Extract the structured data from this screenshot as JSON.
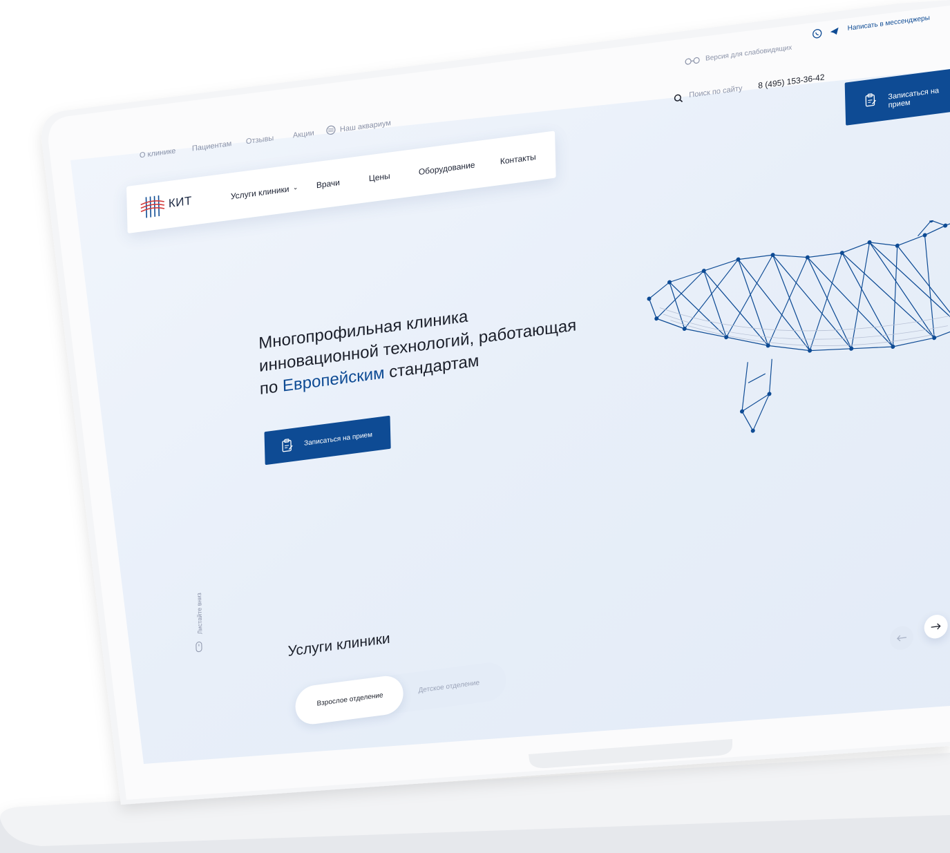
{
  "topbar": {
    "links": [
      "О клинике",
      "Пациентам",
      "Отзывы",
      "Акции"
    ],
    "aquarium": "Наш аквариум",
    "visually_impaired": "Версия для слабовидящих",
    "messenger": "Написать в мессенджеры",
    "search_placeholder": "Поиск по сайту",
    "phone": "8 (495) 153-36-42",
    "book_button": "Записаться на прием"
  },
  "navbar": {
    "logo": "КИТ",
    "items": [
      "Услуги клиники",
      "Врачи",
      "Цены",
      "Оборудование",
      "Контакты"
    ]
  },
  "hero": {
    "line1": "Многопрофильная клиника",
    "line2": "инновационной технологий, работающая",
    "line3_prefix": "по",
    "line3_accent": "Европейским",
    "line3_suffix": "стандартам",
    "button": "Записаться на прием"
  },
  "scroll_hint": "Листайте вниз",
  "services": {
    "title": "Услуги клиники",
    "tab_active": "Взрослое отделение",
    "tab_inactive": "Детское отделение"
  },
  "colors": {
    "accent": "#0e4b94",
    "screen_bg": "#eaf1fb",
    "text": "#1b1f2a",
    "muted": "#8a92a8"
  }
}
